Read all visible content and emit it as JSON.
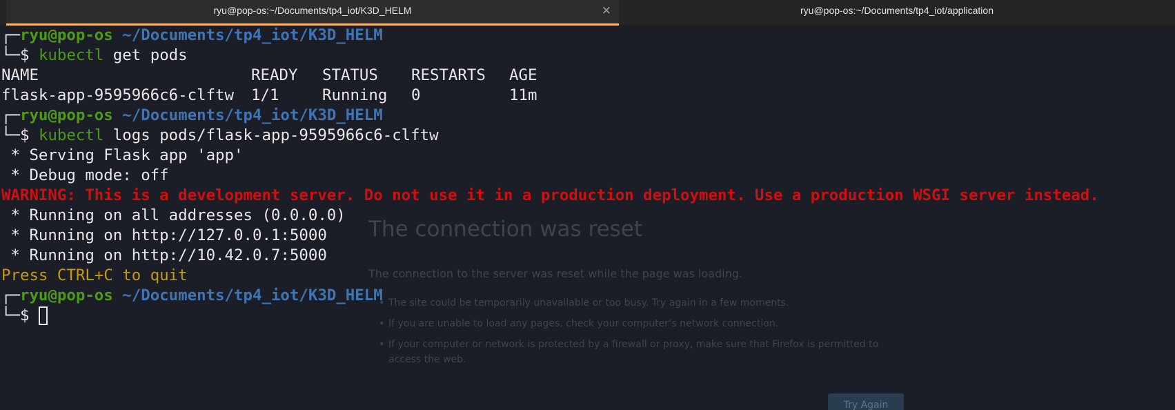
{
  "tabs": [
    {
      "title": "ryu@pop-os:~/Documents/tp4_iot/K3D_HELM",
      "active": true,
      "close_icon": "✕"
    },
    {
      "title": "ryu@pop-os:~/Documents/tp4_iot/application",
      "active": false
    }
  ],
  "colors": {
    "prompt_user": "#4e9a18",
    "prompt_path": "#3f74b5",
    "warning": "#d10f0f",
    "hint": "#c89b0c",
    "active_tab_underline": "#fbb86c"
  },
  "prompt": {
    "corner_top": "┌─",
    "corner_bottom": "└─",
    "user_host": "ryu@pop-os",
    "path": "~/Documents/tp4_iot/K3D_HELM",
    "symbol": "$"
  },
  "commands": [
    {
      "program": "kubectl",
      "args": " get pods"
    },
    {
      "program": "kubectl",
      "args": " logs pods/flask-app-9595966c6-clftw"
    }
  ],
  "pods_table": {
    "headers": [
      "NAME",
      "READY",
      "STATUS",
      "RESTARTS",
      "AGE"
    ],
    "rows": [
      [
        "flask-app-9595966c6-clftw",
        "1/1",
        "Running",
        "0",
        "11m"
      ]
    ]
  },
  "logs": {
    "serving": " * Serving Flask app 'app'",
    "debug": " * Debug mode: off",
    "warning": "WARNING: This is a development server. Do not use it in a production deployment. Use a production WSGI server instead.",
    "running_all": " * Running on all addresses (0.0.0.0)",
    "running_local": " * Running on http://127.0.0.1:5000",
    "running_net": " * Running on http://10.42.0.7:5000",
    "quit_hint": "Press CTRL+C to quit"
  },
  "firefox_error": {
    "title": "The connection was reset",
    "description": "The connection to the server was reset while the page was loading.",
    "items": [
      "The site could be temporarily unavailable or too busy. Try again in a few moments.",
      "If you are unable to load any pages, check your computer’s network connection.",
      "If your computer or network is protected by a firewall or proxy, make sure that Firefox is permitted to access the web."
    ],
    "button_label": "Try Again"
  }
}
